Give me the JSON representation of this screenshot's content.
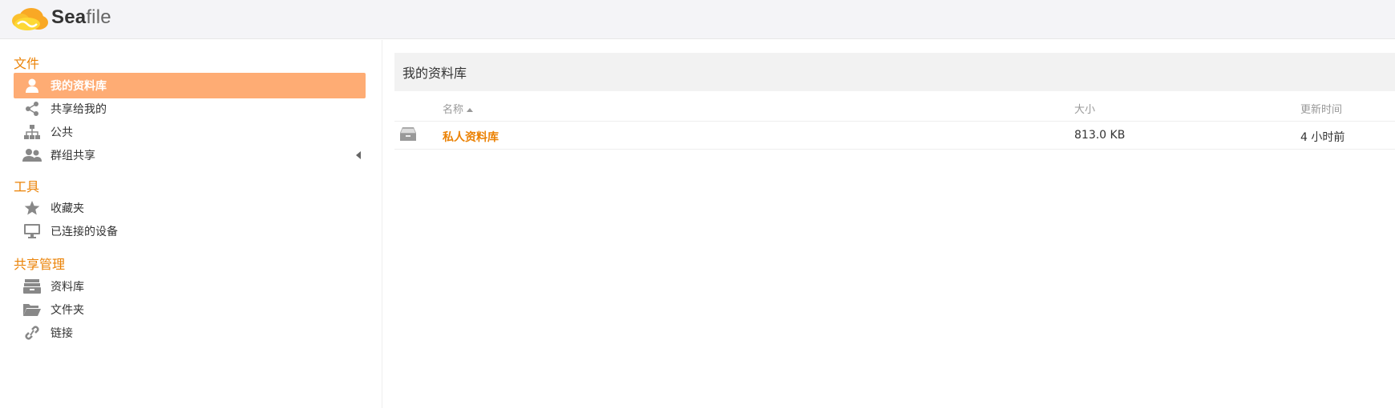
{
  "brand": {
    "name_bold": "Sea",
    "name_light": "file"
  },
  "sidebar": {
    "sections": [
      {
        "title": "文件",
        "items": [
          {
            "label": "我的资料库",
            "icon": "user-icon",
            "active": true
          },
          {
            "label": "共享给我的",
            "icon": "share-icon"
          },
          {
            "label": "公共",
            "icon": "sitemap-icon"
          },
          {
            "label": "群组共享",
            "icon": "users-icon"
          }
        ]
      },
      {
        "title": "工具",
        "items": [
          {
            "label": "收藏夹",
            "icon": "star-icon"
          },
          {
            "label": "已连接的设备",
            "icon": "monitor-icon"
          }
        ]
      },
      {
        "title": "共享管理",
        "items": [
          {
            "label": "资料库",
            "icon": "library-icon"
          },
          {
            "label": "文件夹",
            "icon": "folder-icon"
          },
          {
            "label": "链接",
            "icon": "link-icon"
          }
        ]
      }
    ]
  },
  "main": {
    "title": "我的资料库",
    "columns": {
      "name": "名称",
      "size": "大小",
      "updated": "更新时间"
    },
    "rows": [
      {
        "name": "私人资料库",
        "size": "813.0 KB",
        "updated": "4 小时前",
        "icon": "private-library-icon"
      }
    ]
  },
  "colors": {
    "accent": "#eb8205",
    "active_bg": "#feac74"
  }
}
